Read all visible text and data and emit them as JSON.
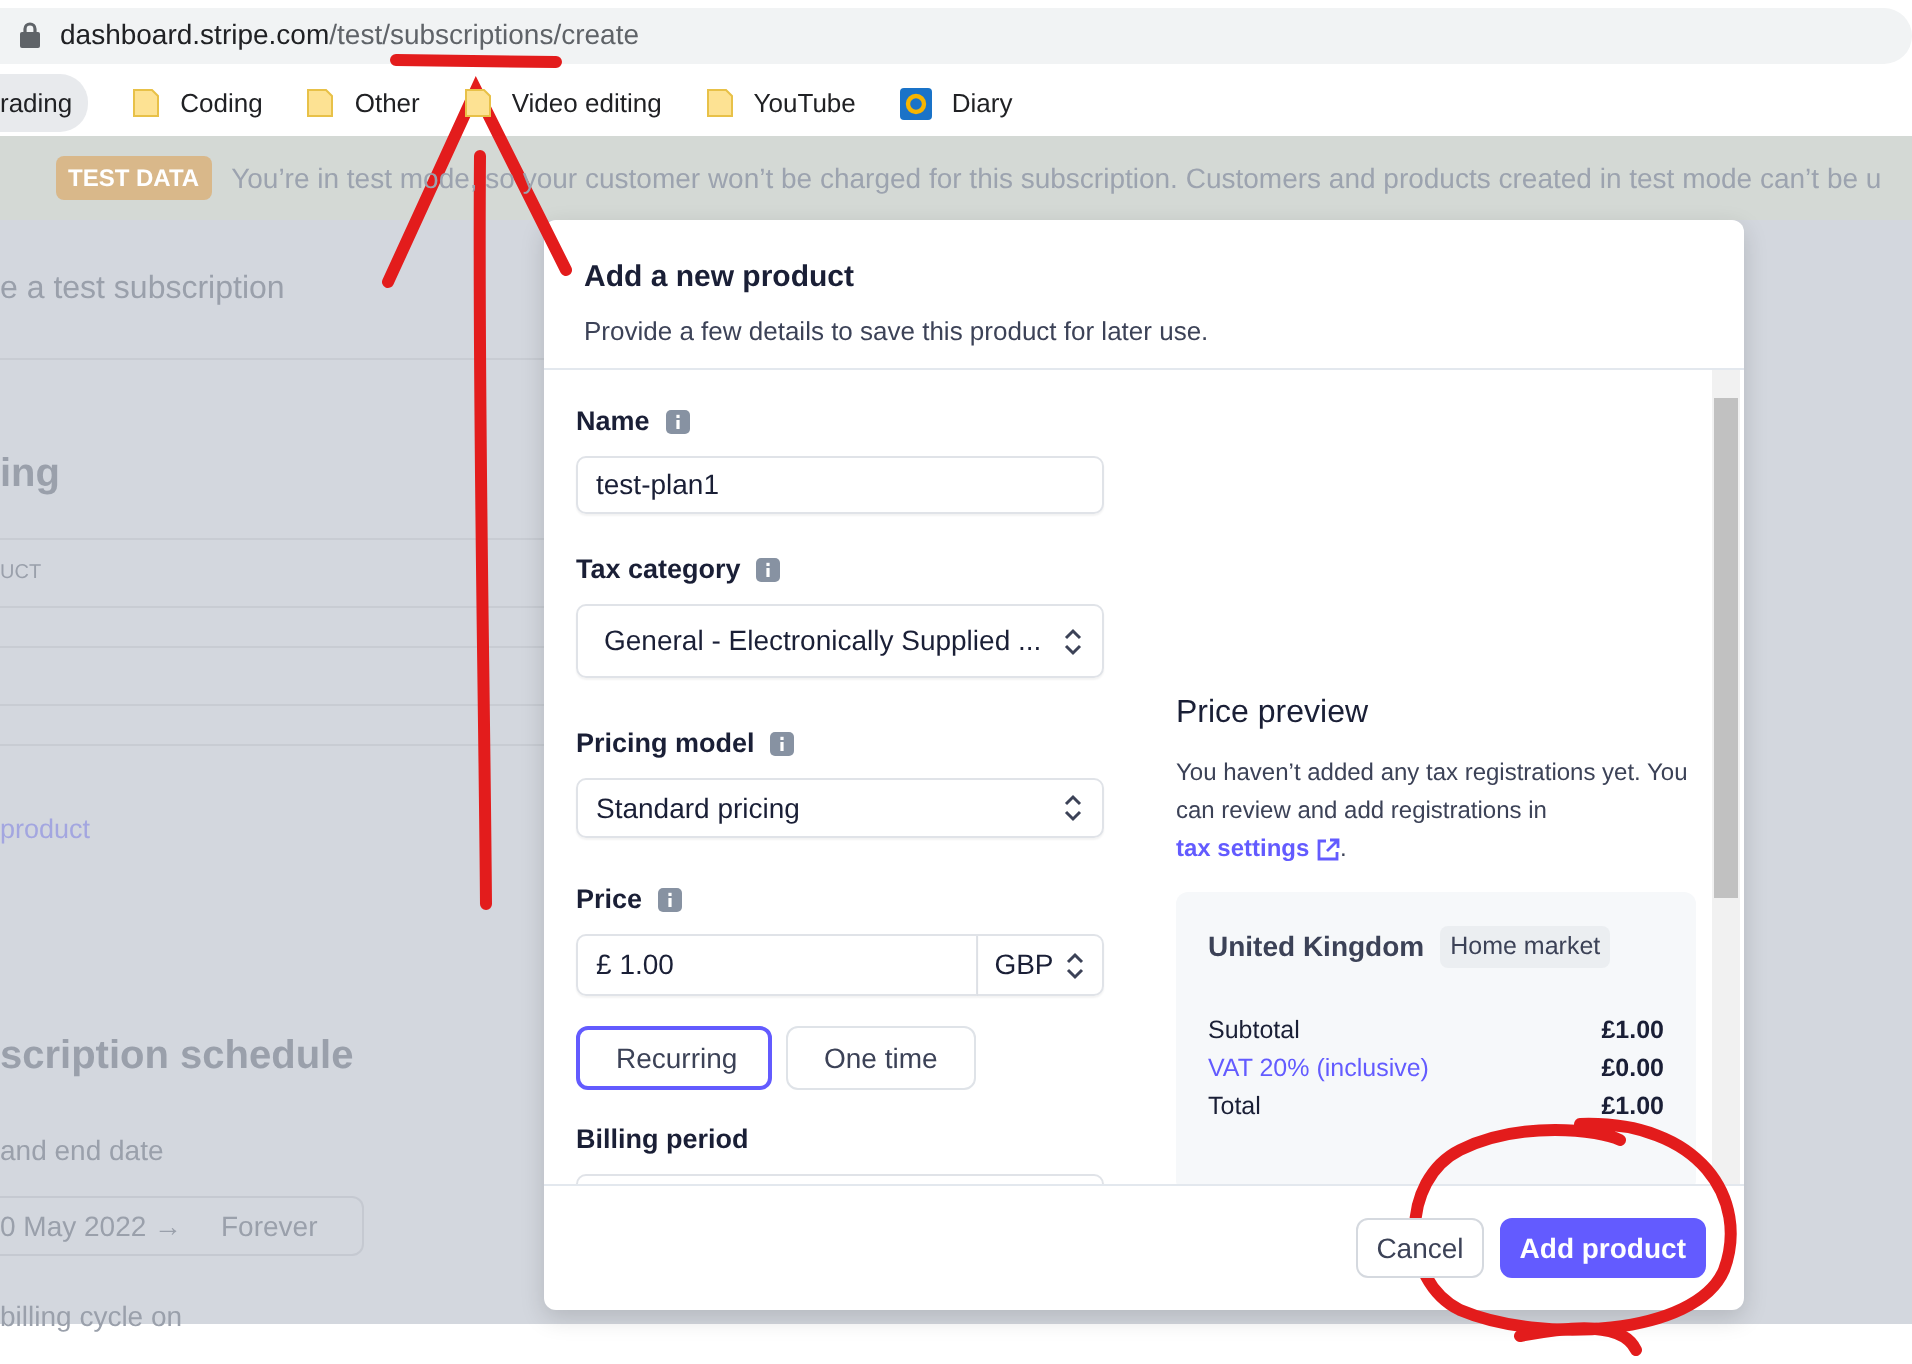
{
  "browser": {
    "url_host": "dashboard.stripe.com",
    "url_path": "/test/subscriptions/create",
    "bookmarks": [
      {
        "label": "rading",
        "kind": "chip"
      },
      {
        "label": "Coding",
        "kind": "folder"
      },
      {
        "label": "Other",
        "kind": "folder"
      },
      {
        "label": "Video editing",
        "kind": "folder"
      },
      {
        "label": "YouTube",
        "kind": "folder"
      },
      {
        "label": "Diary",
        "kind": "app"
      }
    ]
  },
  "banner": {
    "badge": "TEST DATA",
    "text": "You’re in test mode, so your customer won’t be charged for this subscription. Customers and products created in test mode can’t be u"
  },
  "background_page": {
    "title": "e a test subscription",
    "section_title": "ing",
    "column_header": "UCT",
    "link": "product",
    "schedule_title": "scription schedule",
    "date_label": "and end date",
    "start_date": "0 May 2022",
    "date_arrow": "→",
    "end_date": "Forever",
    "cycle_label": "billing cycle on"
  },
  "modal": {
    "title": "Add a new product",
    "subtitle": "Provide a few details to save this product for later use.",
    "fields": [
      {
        "label": "Name",
        "kind": "input",
        "info": true,
        "value": "test-plan1"
      },
      {
        "label": "Tax category",
        "kind": "select-large",
        "info": true,
        "value": "General - Electronically Supplied ..."
      },
      {
        "label": "Pricing model",
        "kind": "select",
        "info": true,
        "value": "Standard pricing"
      },
      {
        "label": "Price",
        "kind": "price",
        "info": true,
        "prefix": "£",
        "value": "1.00",
        "currency": "GBP"
      }
    ],
    "price_type": [
      {
        "label": "Recurring",
        "selected": true
      },
      {
        "label": "One time",
        "selected": false
      }
    ],
    "billing_period": {
      "label": "Billing period"
    },
    "preview": {
      "title": "Price preview",
      "note": "You haven’t added any tax registrations yet. You can review and add registrations in",
      "link": "tax settings",
      "link_end": ".",
      "country": "United Kingdom",
      "tag": "Home market",
      "rows": [
        {
          "label": "Subtotal",
          "value": "£1.00",
          "kind": "plain"
        },
        {
          "label": "VAT 20% (inclusive)",
          "value": "£0.00",
          "kind": "link"
        },
        {
          "label": "Total",
          "value": "£1.00",
          "kind": "plain"
        }
      ]
    },
    "buttons": [
      {
        "label": "Cancel",
        "kind": "secondary"
      },
      {
        "label": "Add product",
        "kind": "primary"
      }
    ]
  }
}
